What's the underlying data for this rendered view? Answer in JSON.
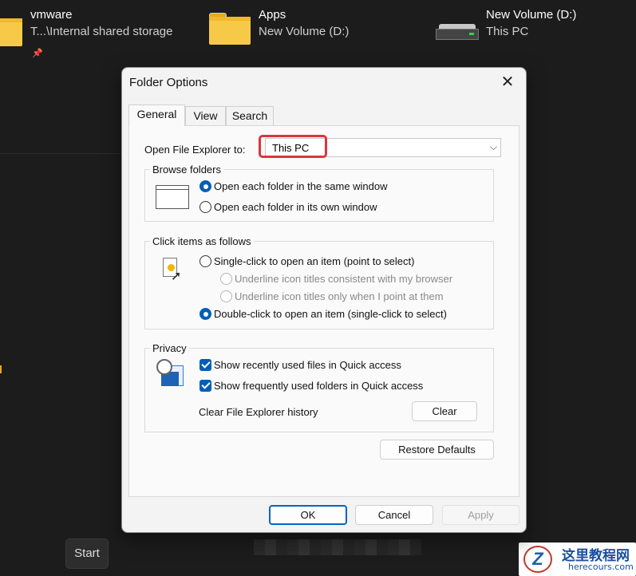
{
  "background": {
    "items": [
      {
        "name": "vmware",
        "subtitle": "T...\\Internal shared storage",
        "icon": "folder-icon",
        "pinned": true
      },
      {
        "name": "Apps",
        "subtitle": "New Volume (D:)",
        "icon": "folder-icon"
      },
      {
        "name": "New Volume (D:)",
        "subtitle": "This PC",
        "icon": "drive-icon"
      }
    ],
    "start_button": "Start",
    "watermark": {
      "line1": "这里教程网",
      "line2": "herecours.com",
      "logo": "Z"
    }
  },
  "dialog": {
    "title": "Folder Options",
    "close_symbol": "✕",
    "tabs": [
      {
        "label": "General",
        "active": true
      },
      {
        "label": "View",
        "active": false
      },
      {
        "label": "Search",
        "active": false
      }
    ],
    "open_explorer": {
      "label": "Open File Explorer to:",
      "value": "This PC"
    },
    "browse_folders": {
      "title": "Browse folders",
      "options": [
        {
          "label": "Open each folder in the same window",
          "selected": true
        },
        {
          "label": "Open each folder in its own window",
          "selected": false
        }
      ]
    },
    "click_items": {
      "title": "Click items as follows",
      "options": [
        {
          "label": "Single-click to open an item (point to select)",
          "selected": false
        },
        {
          "label": "Underline icon titles consistent with my browser",
          "selected": false,
          "disabled": true
        },
        {
          "label": "Underline icon titles only when I point at them",
          "selected": false,
          "disabled": true
        },
        {
          "label": "Double-click to open an item (single-click to select)",
          "selected": true
        }
      ]
    },
    "privacy": {
      "title": "Privacy",
      "checks": [
        {
          "label": "Show recently used files in Quick access",
          "checked": true
        },
        {
          "label": "Show frequently used folders in Quick access",
          "checked": true
        }
      ],
      "clear_label": "Clear File Explorer history",
      "clear_button": "Clear"
    },
    "restore_button": "Restore Defaults",
    "footer": {
      "ok": "OK",
      "cancel": "Cancel",
      "apply": "Apply"
    }
  },
  "colors": {
    "accent": "#005fb8",
    "highlight": "#d9363e",
    "folder": "#f7c948"
  }
}
